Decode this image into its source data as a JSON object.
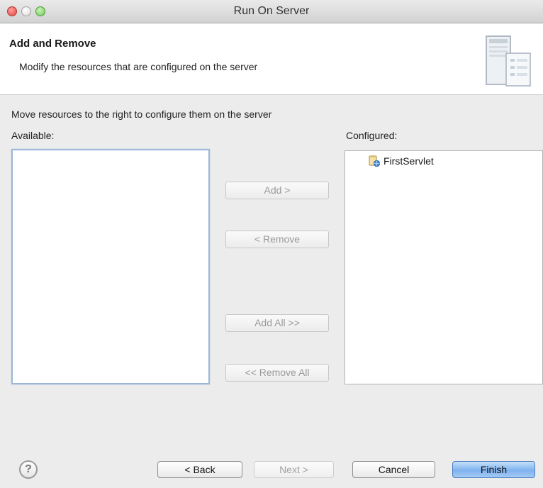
{
  "window": {
    "title": "Run On Server"
  },
  "header": {
    "title": "Add and Remove",
    "description": "Modify the resources that are configured on the server"
  },
  "instruction": "Move resources to the right to configure them on the server",
  "available": {
    "label": "Available:",
    "items": []
  },
  "configured": {
    "label": "Configured:",
    "items": [
      "FirstServlet"
    ]
  },
  "mid_buttons": {
    "add": "Add >",
    "remove": "< Remove",
    "add_all": "Add All >>",
    "remove_all": "<< Remove All"
  },
  "footer": {
    "help_icon": "?",
    "back": "< Back",
    "next": "Next >",
    "cancel": "Cancel",
    "finish": "Finish"
  },
  "colors": {
    "finish_accent": "#7fb2ee",
    "focus_border": "#9cb8d6"
  }
}
